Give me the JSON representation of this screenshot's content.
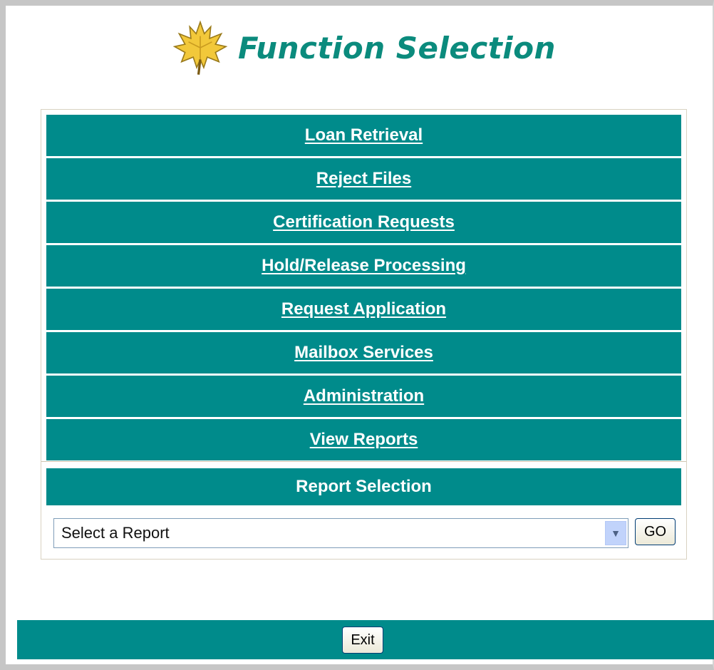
{
  "header": {
    "title": "Function Selection",
    "logo_icon": "maple-leaf-icon",
    "title_color": "#0b8b7d"
  },
  "menu": {
    "items": [
      {
        "label": "Loan Retrieval"
      },
      {
        "label": "Reject Files"
      },
      {
        "label": "Certification Requests"
      },
      {
        "label": "Hold/Release Processing"
      },
      {
        "label": "Request Application"
      },
      {
        "label": "Mailbox Services"
      },
      {
        "label": "Administration"
      },
      {
        "label": "View Reports"
      }
    ],
    "row_color": "#008b8b"
  },
  "report": {
    "header": "Report Selection",
    "select_value": "Select a Report",
    "go_label": "GO"
  },
  "footer": {
    "exit_label": "Exit"
  }
}
